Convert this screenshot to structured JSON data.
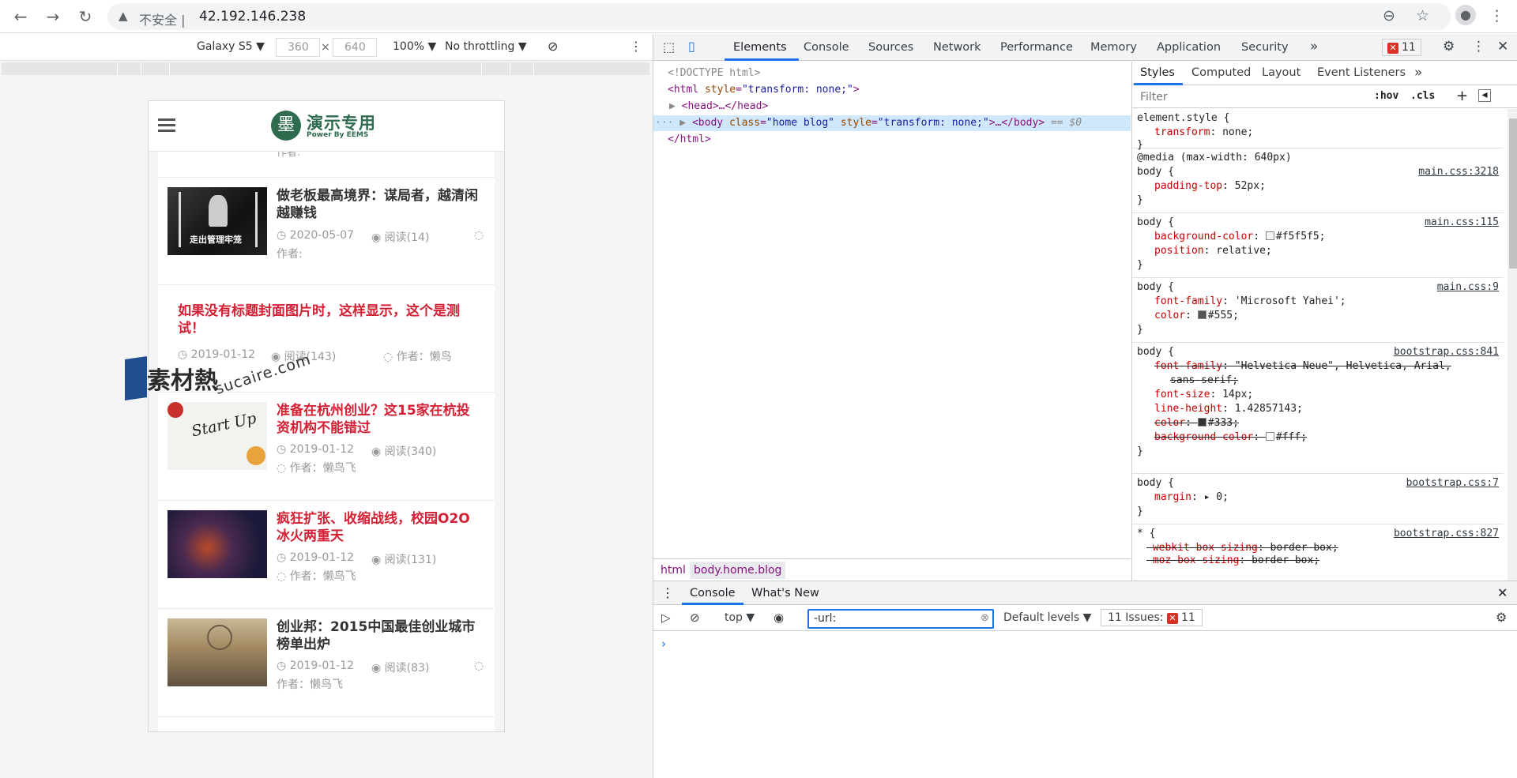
{
  "browser": {
    "security_label": "不安全",
    "url": "42.192.146.238"
  },
  "device_toolbar": {
    "device": "Galaxy S5 ▼",
    "width": "360",
    "height": "640",
    "times": "×",
    "zoom": "100% ▼",
    "throttle": "No throttling ▼"
  },
  "site": {
    "logo_mark": "墨",
    "logo_title": "演示专用",
    "logo_sub": "Power By EEMS",
    "partial_line": "作者:",
    "articles": [
      {
        "title_1": "做老板最高境界：谋局者，越清闲",
        "title_2": "越赚钱",
        "date": "2020-05-07",
        "reads": "阅读(14)",
        "author": "作者:",
        "thumb_text": "走出管理牢笼"
      },
      {
        "title_1": "如果没有标题封面图片时，这样显示，这个是测",
        "title_2": "试！",
        "date": "2019-01-12",
        "reads": "阅读(143)",
        "author": "作者：懒鸟"
      },
      {
        "title_1": "准备在杭州创业？这15家在杭投",
        "title_2": "资机构不能错过",
        "date": "2019-01-12",
        "reads": "阅读(340)",
        "author": "作者：懒鸟飞",
        "thumb_text": "Start Up"
      },
      {
        "title_1": "疯狂扩张、收缩战线，校园O2O",
        "title_2": "冰火两重天",
        "date": "2019-01-12",
        "reads": "阅读(131)",
        "author": "作者：懒鸟飞"
      },
      {
        "title_1": "创业邦：2015中国最佳创业城市",
        "title_2": "榜单出炉",
        "date": "2019-01-12",
        "reads": "阅读(83)",
        "author": "作者：懒鸟飞"
      }
    ]
  },
  "watermark": {
    "text": "素材熱",
    "url": "sucaire.com"
  },
  "devtools": {
    "tabs": [
      "Elements",
      "Console",
      "Sources",
      "Network",
      "Performance",
      "Memory",
      "Application",
      "Security"
    ],
    "more": "»",
    "issues_count": "11",
    "dom": {
      "doctype": "<!DOCTYPE html>",
      "html_open_tag": "<html ",
      "html_attr": "style",
      "html_val": "\"transform: none;\"",
      "head": "<head>…</head>",
      "body_tag": "<body ",
      "body_class_attr": "class",
      "body_class_val": "\"home blog\"",
      "body_style_attr": "style",
      "body_style_val": "\"transform: none;\"",
      "body_tail": ">…</body>",
      "body_ref": " == $0",
      "html_close": "</html>"
    },
    "crumbs": [
      "html",
      "body.home.blog"
    ],
    "styles_tabs": [
      "Styles",
      "Computed",
      "Layout",
      "Event Listeners",
      "»"
    ],
    "filter_placeholder": "Filter",
    "hov": ":hov",
    "cls": ".cls",
    "rules": [
      {
        "selector": "element.style {",
        "source": "",
        "props": [
          {
            "n": "transform",
            "v": "none;",
            "struck": false
          }
        ]
      },
      {
        "selector": "@media (max-width: 640px)",
        "selector2": "body {",
        "source": "main.css:3218",
        "props": [
          {
            "n": "padding-top",
            "v": "52px;",
            "struck": false
          }
        ]
      },
      {
        "selector": "body {",
        "source": "main.css:115",
        "props": [
          {
            "n": "background-color",
            "v": "#f5f5f5;",
            "swatch": "#f5f5f5",
            "struck": false
          },
          {
            "n": "position",
            "v": "relative;",
            "struck": false
          }
        ]
      },
      {
        "selector": "body {",
        "source": "main.css:9",
        "props": [
          {
            "n": "font-family",
            "v": "'Microsoft Yahei';",
            "struck": false
          },
          {
            "n": "color",
            "v": "#555;",
            "swatch": "#555555",
            "struck": false
          }
        ]
      },
      {
        "selector": "body {",
        "source": "bootstrap.css:841",
        "props": [
          {
            "n": "font-family",
            "v": "\"Helvetica Neue\", Helvetica, Arial,",
            "v2": "sans-serif;",
            "struck": true
          },
          {
            "n": "font-size",
            "v": "14px;",
            "struck": false
          },
          {
            "n": "line-height",
            "v": "1.42857143;",
            "struck": false
          },
          {
            "n": "color",
            "v": "#333;",
            "swatch": "#333333",
            "struck": true
          },
          {
            "n": "background-color",
            "v": "#fff;",
            "swatch": "#ffffff",
            "struck": true
          }
        ]
      },
      {
        "selector": "body {",
        "source": "bootstrap.css:7",
        "props": [
          {
            "n": "margin",
            "v": "▸ 0;",
            "struck": false
          }
        ]
      },
      {
        "selector": "* {",
        "source": "bootstrap.css:827",
        "props": [
          {
            "n": "-webkit-box-sizing",
            "v": "border-box;",
            "struck": true
          },
          {
            "n": "-moz-box-sizing",
            "v": "border-box;",
            "struck": true
          }
        ]
      }
    ],
    "drawer": {
      "tabs": [
        "Console",
        "What's New"
      ],
      "context": "top ▼",
      "filter_value": "-url:",
      "levels": "Default levels ▼",
      "issues": "11 Issues:",
      "issues_count": "11",
      "prompt": "›"
    }
  }
}
